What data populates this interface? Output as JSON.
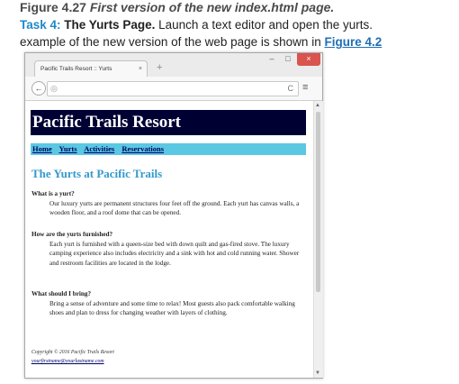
{
  "caption": {
    "figure_label": "Figure 4.27",
    "figure_desc": "First version of the new index.html page.",
    "task_label": "Task 4:",
    "task_title": "The Yurts Page.",
    "task_text": "Launch a text editor and open the yurts.",
    "example_text": "example of the new version of the web page is shown in",
    "figure_ref": "Figure 4.2"
  },
  "browser": {
    "tab_title": "Pacific Trails Resort :: Yurts",
    "tab_close": "×",
    "new_tab": "+",
    "minimize": "–",
    "maximize": "□",
    "close": "×",
    "back": "←",
    "page_icon": "◎",
    "reload": "C",
    "menu": "≡"
  },
  "page": {
    "site_title": "Pacific Trails Resort",
    "nav": [
      "Home",
      "Yurts",
      "Activities",
      "Reservations"
    ],
    "heading": "The Yurts at Pacific Trails",
    "faq": [
      {
        "q": "What is a yurt?",
        "a": "Our luxury yurts are permanent structures four feet off the ground. Each yurt has canvas walls, a wooden floor, and a roof dome that can be opened."
      },
      {
        "q": "How are the yurts furnished?",
        "a": "Each yurt is furnished with a queen-size bed with down quilt and gas-fired stove. The luxury camping experience also includes electricity and a sink with hot and cold running water. Shower and restroom facilities are located in the lodge."
      },
      {
        "q": "What should I bring?",
        "a": "Bring a sense of adventure and some time to relax! Most guests also pack comfortable walking shoes and plan to dress for changing weather with layers of clothing."
      }
    ],
    "footer": {
      "copyright": "Copyright © 2016 Pacific Trails Resort",
      "email": "yourfirstname@yourlastname.com"
    }
  }
}
